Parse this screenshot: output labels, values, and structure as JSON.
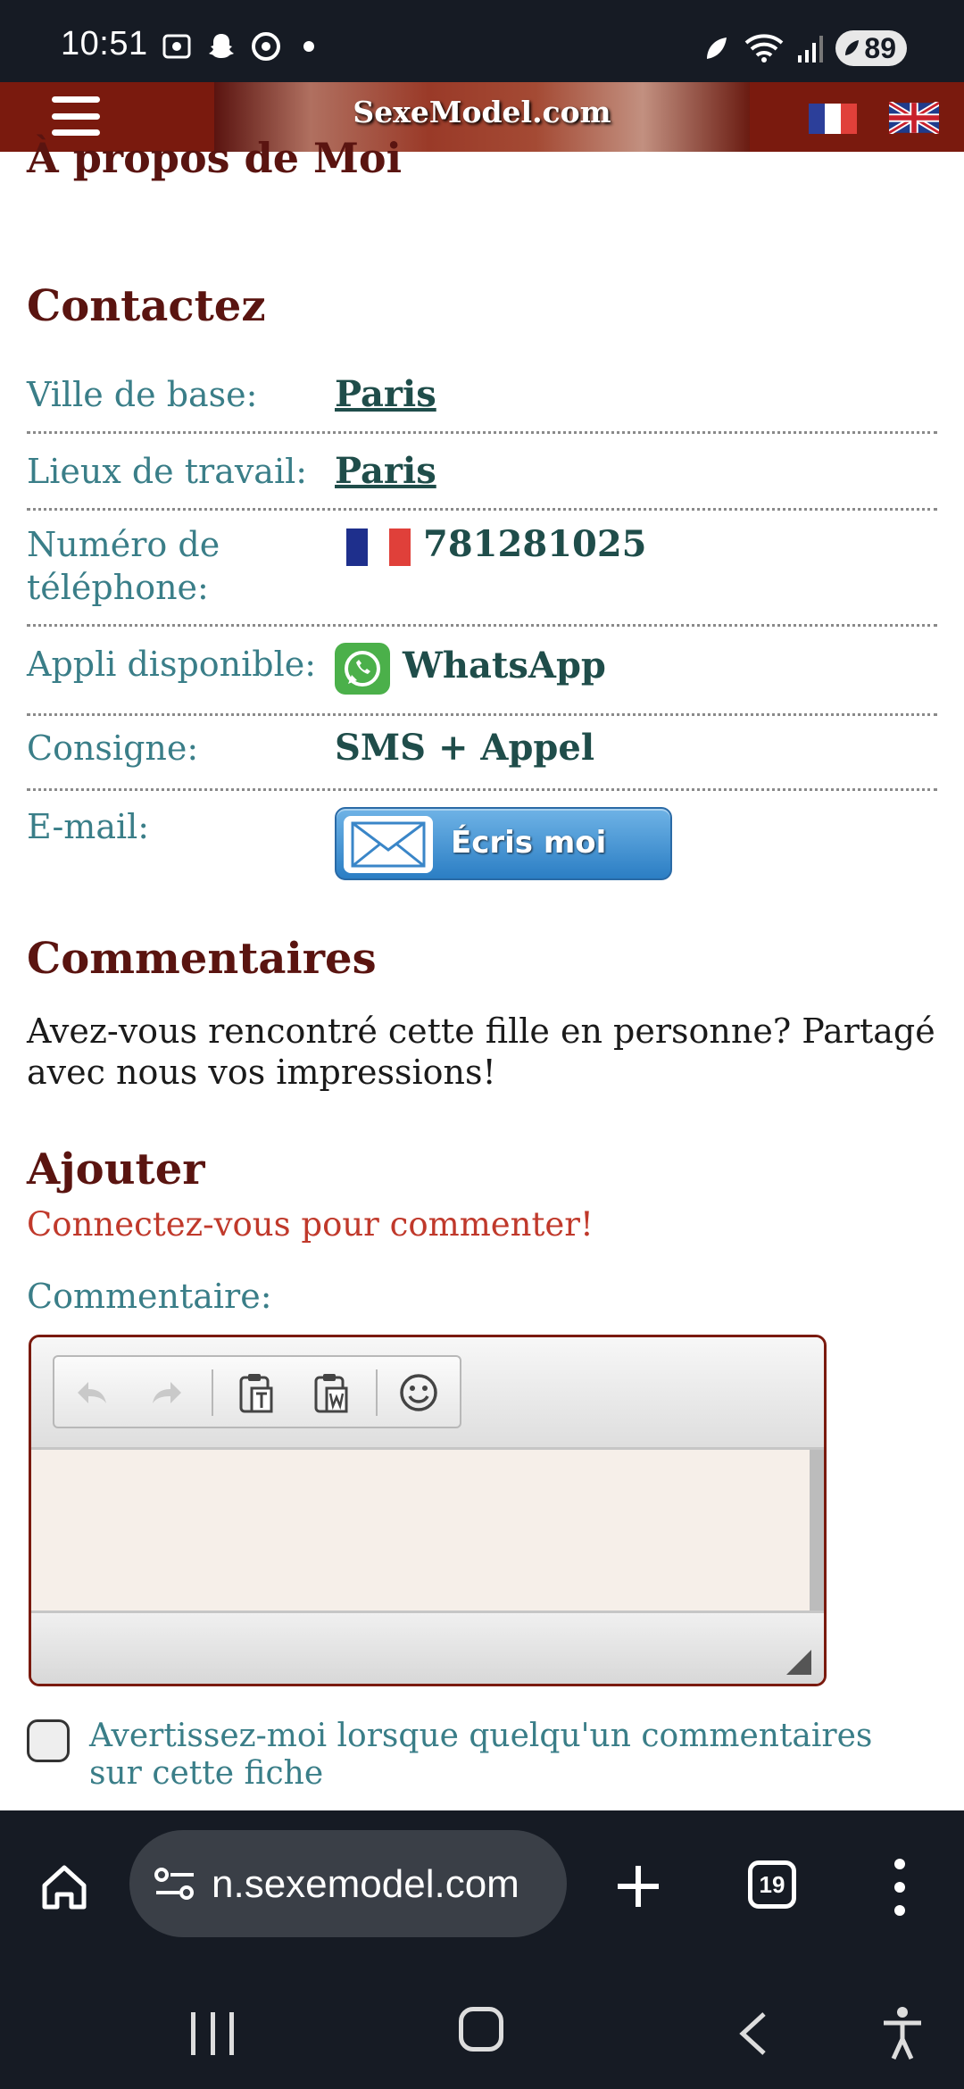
{
  "status_bar": {
    "time": "10:51",
    "battery": "89"
  },
  "header": {
    "site_title": "SexeModel.com",
    "lang_fr": "flag-france-icon",
    "lang_en": "flag-uk-icon"
  },
  "profile": {
    "about_heading": "À propos de Moi",
    "contact_heading": "Contactez",
    "rows": [
      {
        "label": "Ville de base:",
        "value": "Paris"
      },
      {
        "label": "Lieux de travail:",
        "value": "Paris"
      },
      {
        "label": "Numéro de téléphone:",
        "value": "781281025"
      },
      {
        "label": "Appli disponible:",
        "value": "WhatsApp"
      },
      {
        "label": "Consigne:",
        "value": "SMS + Appel"
      },
      {
        "label": "E-mail:",
        "value": "Écris moi"
      }
    ]
  },
  "comments": {
    "heading": "Commentaires",
    "intro": "Avez-vous rencontré cette fille en personne? Partagé avec nous vos impressions!",
    "add_heading": "Ajouter",
    "login_prompt": "Connectez-vous pour commenter!",
    "field_label": "Commentaire:",
    "notify_label": "Avertissez-moi lorsque quelqu'un commentaires sur cette fiche",
    "notify_checked": false
  },
  "browser": {
    "url": "n.sexemodel.com",
    "tab_count": "19"
  },
  "colors": {
    "header_bg": "#7a1a0e",
    "heading": "#5a1410",
    "label": "#3a7e88",
    "value": "#1f4d4a",
    "warning": "#c0392b",
    "dark_bar": "#161b24"
  }
}
